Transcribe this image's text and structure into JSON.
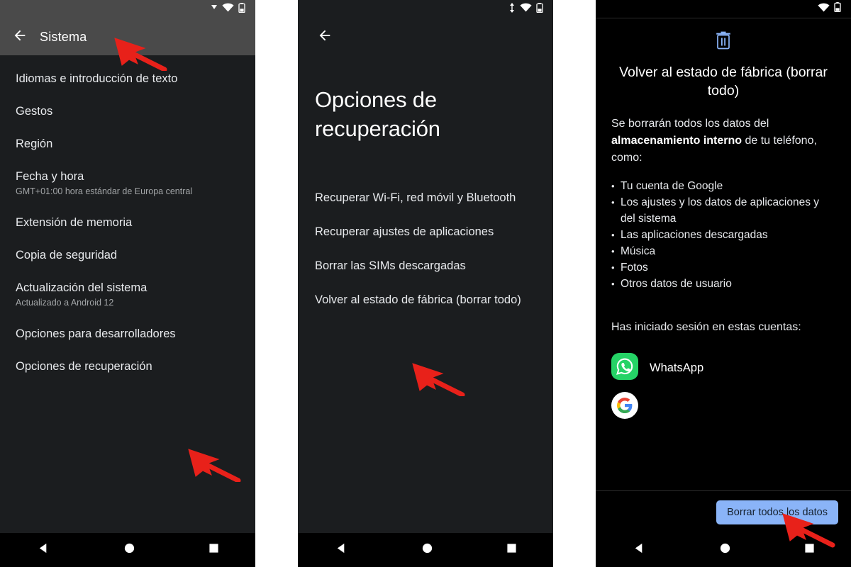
{
  "panel1": {
    "statusbar": {
      "icons": [
        "signal-triangle-icon",
        "wifi-icon",
        "battery-icon"
      ]
    },
    "appbar": {
      "back_icon": "back-arrow-icon",
      "title": "Sistema"
    },
    "items": [
      {
        "title": "Idiomas e introducción de texto",
        "subtitle": ""
      },
      {
        "title": "Gestos",
        "subtitle": ""
      },
      {
        "title": "Región",
        "subtitle": ""
      },
      {
        "title": "Fecha y hora",
        "subtitle": "GMT+01:00 hora estándar de Europa central"
      },
      {
        "title": "Extensión de memoria",
        "subtitle": ""
      },
      {
        "title": "Copia de seguridad",
        "subtitle": ""
      },
      {
        "title": "Actualización del sistema",
        "subtitle": "Actualizado a Android 12"
      },
      {
        "title": "Opciones para desarrolladores",
        "subtitle": ""
      },
      {
        "title": "Opciones de recuperación",
        "subtitle": ""
      }
    ]
  },
  "panel2": {
    "statusbar": {
      "icons": [
        "data-transfer-icon",
        "wifi-icon",
        "battery-icon"
      ]
    },
    "back_icon": "back-arrow-icon",
    "title": "Opciones de recuperación",
    "items": [
      {
        "title": "Recuperar Wi-Fi, red móvil y Bluetooth"
      },
      {
        "title": "Recuperar ajustes de aplicaciones"
      },
      {
        "title": "Borrar las SIMs descargadas"
      },
      {
        "title": "Volver al estado de fábrica (borrar todo)"
      }
    ]
  },
  "panel3": {
    "statusbar": {
      "icons": [
        "wifi-icon",
        "battery-icon"
      ]
    },
    "header_icon": "trash-icon",
    "title": "Volver al estado de fábrica (borrar todo)",
    "paragraph_before": "Se borrarán todos los datos del ",
    "paragraph_bold": "almacenamiento interno",
    "paragraph_after": " de tu teléfono, como:",
    "bullets": [
      "Tu cuenta de Google",
      "Los ajustes y los datos de aplicaciones y del sistema",
      "Las aplicaciones descargadas",
      "Música",
      "Fotos",
      "Otros datos de usuario"
    ],
    "accounts_label": "Has iniciado sesión en estas cuentas:",
    "accounts": [
      {
        "name": "WhatsApp",
        "icon": "whatsapp-icon"
      },
      {
        "name": "",
        "icon": "google-icon"
      }
    ],
    "primary_button": "Borrar todos los datos"
  },
  "navbar": {
    "back": "nav-back-icon",
    "home": "nav-home-icon",
    "recents": "nav-recents-icon"
  },
  "annotations": {
    "color": "#e8211a",
    "arrows": [
      {
        "target": "Sistema"
      },
      {
        "target": "Opciones de recuperación"
      },
      {
        "target": "Volver al estado de fábrica (borrar todo)"
      },
      {
        "target": "Borrar todos los datos"
      }
    ]
  },
  "colors": {
    "appbar": "#4a4a4a",
    "body_dark": "#1b1d1f",
    "dialog_dark": "#000000",
    "accent_button": "#8ab4f8",
    "annotation_red": "#e8211a",
    "whatsapp_green": "#25d366"
  }
}
